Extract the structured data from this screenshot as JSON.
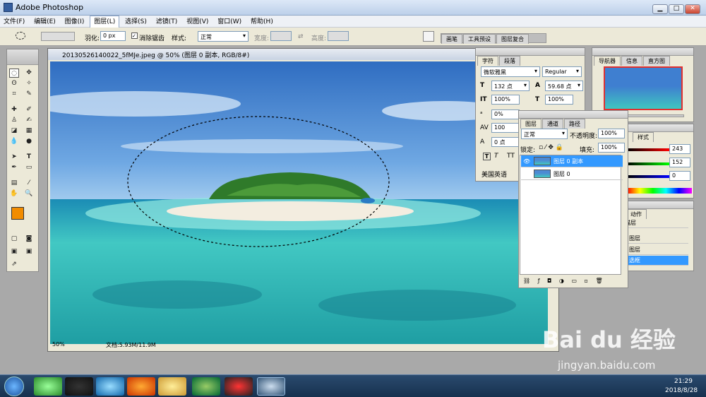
{
  "window": {
    "title": "Adobe Photoshop"
  },
  "menu": [
    "文件(F)",
    "编辑(E)",
    "图像(I)",
    "图层(L)",
    "选择(S)",
    "滤镜(T)",
    "视图(V)",
    "窗口(W)",
    "帮助(H)"
  ],
  "options": {
    "feather_label": "羽化:",
    "feather_value": "0 px",
    "antialias_label": "消除锯齿",
    "style_label": "样式:",
    "style_value": "正常",
    "width_label": "宽度:",
    "height_label": "高度:",
    "tabs": [
      "画笔",
      "工具预设",
      "图层复合"
    ]
  },
  "document": {
    "title": "20130526140022_5fMJe.jpeg @ 50% (图层 0 副本, RGB/8#)",
    "zoom": "50%",
    "doc_info": "文档:5.93M/11.9M"
  },
  "navigator": {
    "tabs": [
      "导航器",
      "信息",
      "直方图"
    ]
  },
  "character": {
    "tabs": [
      "字符",
      "段落"
    ],
    "font": "微软雅黑",
    "style": "Regular",
    "size": "132 点",
    "leading": "59.68 点",
    "vscale": "100%",
    "hscale": "100%",
    "tracking_pct": "0%",
    "tracking": "100",
    "baseline": "0 点",
    "language": "美国英语"
  },
  "layers": {
    "tabs": [
      "图层",
      "通道",
      "路径"
    ],
    "blend": "正常",
    "opacity_label": "不透明度:",
    "opacity": "100%",
    "lock_label": "锁定:",
    "fill_label": "填充:",
    "fill": "100%",
    "items": [
      {
        "name": "图层 0 副本",
        "selected": true
      },
      {
        "name": "图层 0",
        "selected": false
      }
    ]
  },
  "color": {
    "tab": "样式",
    "values": [
      "243",
      "152",
      "0"
    ]
  },
  "history": {
    "tab": "动作",
    "items": [
      "描层",
      "图层",
      "图层",
      "选框"
    ]
  },
  "tray": {
    "time": "21:29",
    "date": "2018/8/28"
  },
  "watermark": {
    "brand": "Bai du 经验",
    "url": "jingyan.baidu.com"
  },
  "colors": {
    "foreground": "#f28c00",
    "selection": "#3399ff"
  }
}
